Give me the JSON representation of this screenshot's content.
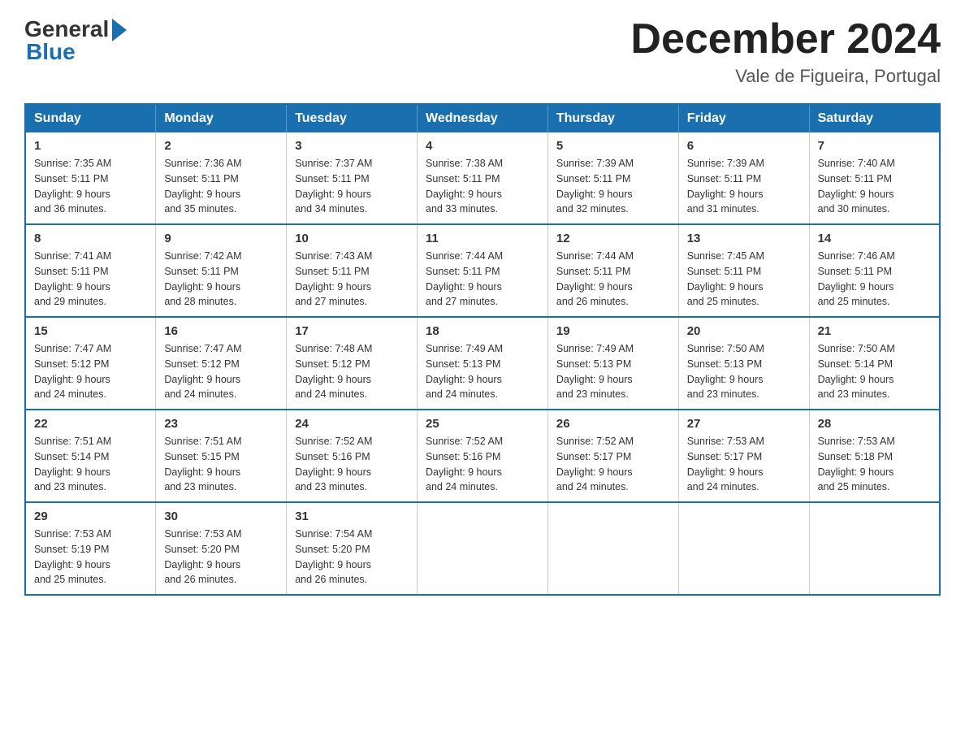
{
  "header": {
    "logo_general": "General",
    "logo_blue": "Blue",
    "month_title": "December 2024",
    "location": "Vale de Figueira, Portugal"
  },
  "days_of_week": [
    "Sunday",
    "Monday",
    "Tuesday",
    "Wednesday",
    "Thursday",
    "Friday",
    "Saturday"
  ],
  "weeks": [
    [
      {
        "day": "1",
        "sunrise": "7:35 AM",
        "sunset": "5:11 PM",
        "daylight": "9 hours and 36 minutes."
      },
      {
        "day": "2",
        "sunrise": "7:36 AM",
        "sunset": "5:11 PM",
        "daylight": "9 hours and 35 minutes."
      },
      {
        "day": "3",
        "sunrise": "7:37 AM",
        "sunset": "5:11 PM",
        "daylight": "9 hours and 34 minutes."
      },
      {
        "day": "4",
        "sunrise": "7:38 AM",
        "sunset": "5:11 PM",
        "daylight": "9 hours and 33 minutes."
      },
      {
        "day": "5",
        "sunrise": "7:39 AM",
        "sunset": "5:11 PM",
        "daylight": "9 hours and 32 minutes."
      },
      {
        "day": "6",
        "sunrise": "7:39 AM",
        "sunset": "5:11 PM",
        "daylight": "9 hours and 31 minutes."
      },
      {
        "day": "7",
        "sunrise": "7:40 AM",
        "sunset": "5:11 PM",
        "daylight": "9 hours and 30 minutes."
      }
    ],
    [
      {
        "day": "8",
        "sunrise": "7:41 AM",
        "sunset": "5:11 PM",
        "daylight": "9 hours and 29 minutes."
      },
      {
        "day": "9",
        "sunrise": "7:42 AM",
        "sunset": "5:11 PM",
        "daylight": "9 hours and 28 minutes."
      },
      {
        "day": "10",
        "sunrise": "7:43 AM",
        "sunset": "5:11 PM",
        "daylight": "9 hours and 27 minutes."
      },
      {
        "day": "11",
        "sunrise": "7:44 AM",
        "sunset": "5:11 PM",
        "daylight": "9 hours and 27 minutes."
      },
      {
        "day": "12",
        "sunrise": "7:44 AM",
        "sunset": "5:11 PM",
        "daylight": "9 hours and 26 minutes."
      },
      {
        "day": "13",
        "sunrise": "7:45 AM",
        "sunset": "5:11 PM",
        "daylight": "9 hours and 25 minutes."
      },
      {
        "day": "14",
        "sunrise": "7:46 AM",
        "sunset": "5:11 PM",
        "daylight": "9 hours and 25 minutes."
      }
    ],
    [
      {
        "day": "15",
        "sunrise": "7:47 AM",
        "sunset": "5:12 PM",
        "daylight": "9 hours and 24 minutes."
      },
      {
        "day": "16",
        "sunrise": "7:47 AM",
        "sunset": "5:12 PM",
        "daylight": "9 hours and 24 minutes."
      },
      {
        "day": "17",
        "sunrise": "7:48 AM",
        "sunset": "5:12 PM",
        "daylight": "9 hours and 24 minutes."
      },
      {
        "day": "18",
        "sunrise": "7:49 AM",
        "sunset": "5:13 PM",
        "daylight": "9 hours and 24 minutes."
      },
      {
        "day": "19",
        "sunrise": "7:49 AM",
        "sunset": "5:13 PM",
        "daylight": "9 hours and 23 minutes."
      },
      {
        "day": "20",
        "sunrise": "7:50 AM",
        "sunset": "5:13 PM",
        "daylight": "9 hours and 23 minutes."
      },
      {
        "day": "21",
        "sunrise": "7:50 AM",
        "sunset": "5:14 PM",
        "daylight": "9 hours and 23 minutes."
      }
    ],
    [
      {
        "day": "22",
        "sunrise": "7:51 AM",
        "sunset": "5:14 PM",
        "daylight": "9 hours and 23 minutes."
      },
      {
        "day": "23",
        "sunrise": "7:51 AM",
        "sunset": "5:15 PM",
        "daylight": "9 hours and 23 minutes."
      },
      {
        "day": "24",
        "sunrise": "7:52 AM",
        "sunset": "5:16 PM",
        "daylight": "9 hours and 23 minutes."
      },
      {
        "day": "25",
        "sunrise": "7:52 AM",
        "sunset": "5:16 PM",
        "daylight": "9 hours and 24 minutes."
      },
      {
        "day": "26",
        "sunrise": "7:52 AM",
        "sunset": "5:17 PM",
        "daylight": "9 hours and 24 minutes."
      },
      {
        "day": "27",
        "sunrise": "7:53 AM",
        "sunset": "5:17 PM",
        "daylight": "9 hours and 24 minutes."
      },
      {
        "day": "28",
        "sunrise": "7:53 AM",
        "sunset": "5:18 PM",
        "daylight": "9 hours and 25 minutes."
      }
    ],
    [
      {
        "day": "29",
        "sunrise": "7:53 AM",
        "sunset": "5:19 PM",
        "daylight": "9 hours and 25 minutes."
      },
      {
        "day": "30",
        "sunrise": "7:53 AM",
        "sunset": "5:20 PM",
        "daylight": "9 hours and 26 minutes."
      },
      {
        "day": "31",
        "sunrise": "7:54 AM",
        "sunset": "5:20 PM",
        "daylight": "9 hours and 26 minutes."
      },
      null,
      null,
      null,
      null
    ]
  ],
  "labels": {
    "sunrise": "Sunrise:",
    "sunset": "Sunset:",
    "daylight": "Daylight:"
  }
}
